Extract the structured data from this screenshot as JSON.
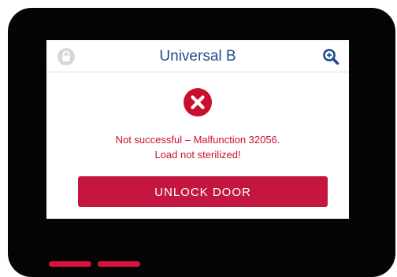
{
  "header": {
    "title": "Universal B",
    "left_icon": "lock-icon",
    "right_icon": "search-icon"
  },
  "status": {
    "icon": "error-icon",
    "message_line_1": "Not successful – Malfunction 32056.",
    "message_line_2": "Load not sterilized!"
  },
  "actions": {
    "unlock_label": "UNLOCK DOOR"
  },
  "indicators": {
    "count": 2,
    "color": "#d8123c"
  },
  "colors": {
    "accent": "#c41740",
    "error": "#c8102e",
    "title": "#1e4e8c",
    "bezel": "#050505",
    "icon_disabled": "#d4d8dc"
  }
}
